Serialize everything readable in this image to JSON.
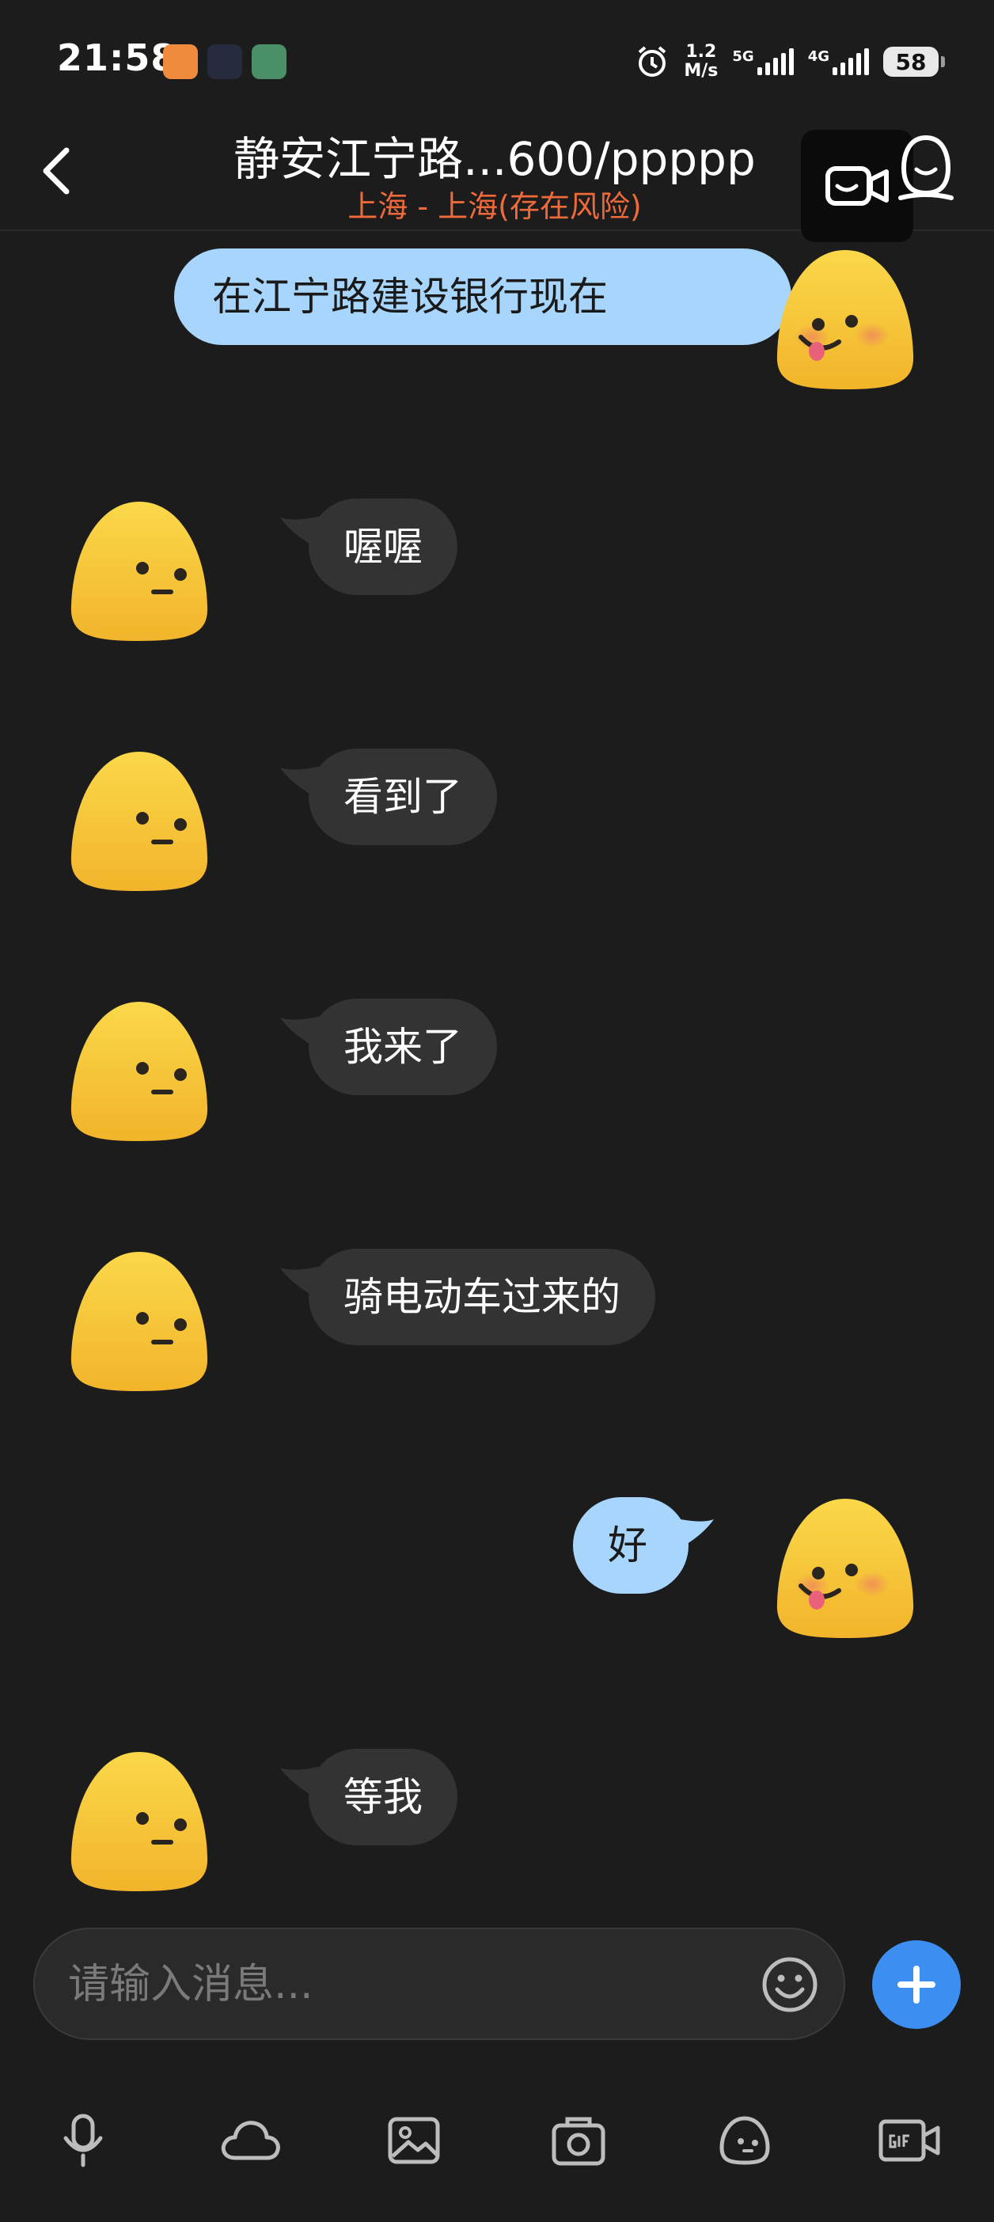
{
  "status_bar": {
    "time": "21:58",
    "net_speed_value": "1.2",
    "net_speed_unit": "M/s",
    "signal1_label": "5G",
    "signal2_label": "4G",
    "battery": "58"
  },
  "header": {
    "title": "静安江宁路...600/ppppp",
    "subtitle": "上海 - 上海(存在风险)"
  },
  "messages": [
    {
      "side": "out",
      "text": "在江宁路建设银行现在"
    },
    {
      "side": "in",
      "text": "喔喔"
    },
    {
      "side": "in",
      "text": "看到了"
    },
    {
      "side": "in",
      "text": "我来了"
    },
    {
      "side": "in",
      "text": "骑电动车过来的"
    },
    {
      "side": "out",
      "text": "好"
    },
    {
      "side": "in",
      "text": "等我"
    }
  ],
  "input": {
    "placeholder": "请输入消息...",
    "value": ""
  },
  "toolbar_icons": [
    "microphone-icon",
    "cloud-icon",
    "image-icon",
    "camera-icon",
    "sticker-icon",
    "gif-icon"
  ],
  "colors": {
    "background": "#1c1c1c",
    "outgoing_bubble": "#a8d5fb",
    "incoming_bubble": "#333333",
    "risk_text": "#ef6a3a",
    "accent": "#3c8ff0",
    "avatar_yellow": "#f7c434"
  }
}
